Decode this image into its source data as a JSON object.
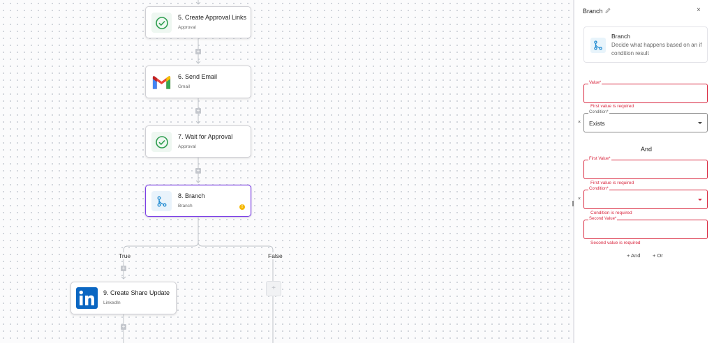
{
  "flow": {
    "steps": [
      {
        "title": "5. Create Approval Links",
        "subtitle": "Approval"
      },
      {
        "title": "6. Send Email",
        "subtitle": "Gmail"
      },
      {
        "title": "7. Wait for Approval",
        "subtitle": "Approval"
      },
      {
        "title": "8. Branch",
        "subtitle": "Branch"
      },
      {
        "title": "9. Create Share Update",
        "subtitle": "LinkedIn"
      }
    ],
    "true_label": "True",
    "false_label": "False",
    "add_symbol": "+"
  },
  "panel": {
    "title": "Branch",
    "close": "×",
    "info": {
      "title": "Branch",
      "description": "Decide what happens based on an if condition result"
    },
    "group1": {
      "value_label": "Value*",
      "value_error": "First value is required",
      "condition_label": "Condition*",
      "condition_value": "Exists"
    },
    "and_text": "And",
    "group2": {
      "first_label": "First Value*",
      "first_error": "First value is required",
      "condition_label": "Condition*",
      "condition_error": "Condition is required",
      "second_label": "Second Value*",
      "second_error": "Second value is required"
    },
    "remove_symbol": "×",
    "and_button": "+ And",
    "or_button": "+ Or"
  },
  "colors": {
    "accent": "#7b3fe4",
    "error": "#d9263e",
    "approval_green": "#2e9e4f",
    "branch_blue": "#1f8ad1",
    "linkedin_blue": "#0a66c2"
  }
}
